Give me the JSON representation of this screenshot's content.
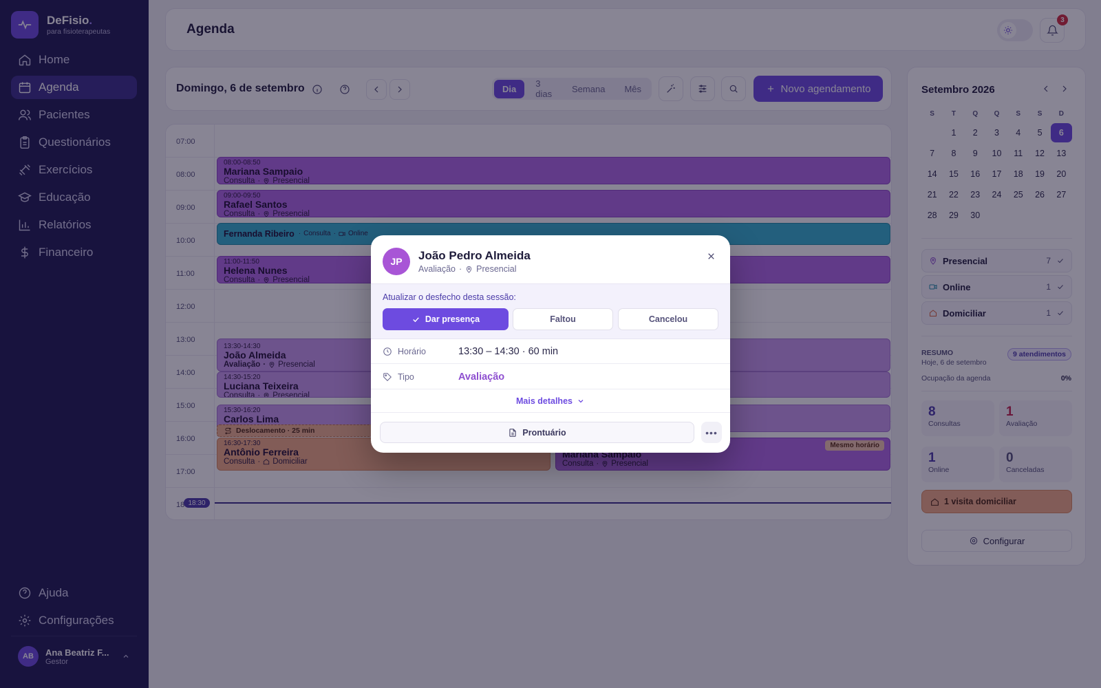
{
  "brand": {
    "name": "DeFisio",
    "dot": ".",
    "subtitle": "para fisioterapeutas"
  },
  "nav": {
    "items": [
      {
        "label": "Home",
        "icon": "home-icon"
      },
      {
        "label": "Agenda",
        "icon": "calendar-icon",
        "active": true
      },
      {
        "label": "Pacientes",
        "icon": "users-icon"
      },
      {
        "label": "Questionários",
        "icon": "clipboard-icon"
      },
      {
        "label": "Exercícios",
        "icon": "dumbbell-icon"
      },
      {
        "label": "Educação",
        "icon": "graduation-cap-icon"
      },
      {
        "label": "Relatórios",
        "icon": "bar-chart-icon"
      },
      {
        "label": "Financeiro",
        "icon": "dollar-icon"
      }
    ],
    "bottom": [
      {
        "label": "Ajuda",
        "icon": "help-circle-icon"
      },
      {
        "label": "Configurações",
        "icon": "gear-icon"
      }
    ]
  },
  "user": {
    "initials": "AB",
    "name": "Ana Beatriz F...",
    "role": "Gestor"
  },
  "header": {
    "title": "Agenda",
    "notification_count": "3"
  },
  "toolbar": {
    "date": "Domingo, 6 de setembro",
    "views": [
      "Dia",
      "3 dias",
      "Semana",
      "Mês"
    ],
    "active_view": "Dia",
    "new_button": "Novo agendamento"
  },
  "grid": {
    "hours": [
      "07:00",
      "08:00",
      "09:00",
      "10:00",
      "11:00",
      "12:00",
      "13:00",
      "14:00",
      "15:00",
      "16:00",
      "17:00",
      "18"
    ],
    "now": "18:30",
    "events": {
      "e1": {
        "time": "08:00-08:50",
        "name": "Mariana Sampaio",
        "type": "Consulta",
        "mode": "Presencial"
      },
      "e2": {
        "time": "09:00-09:50",
        "name": "Rafael Santos",
        "type": "Consulta",
        "mode": "Presencial"
      },
      "e3": {
        "name": "Fernanda Ribeiro",
        "type": "Consulta",
        "mode": "Online"
      },
      "e4": {
        "time": "11:00-11:50",
        "name": "Helena Nunes",
        "type": "Consulta",
        "mode": "Presencial"
      },
      "e5": {
        "time": "13:30-14:30",
        "name": "João Almeida",
        "type": "Avaliação",
        "mode": "Presencial"
      },
      "e6": {
        "time": "14:30-15:20",
        "name": "Luciana Teixeira",
        "type": "Consulta",
        "mode": "Presencial"
      },
      "e7": {
        "time": "15:30-16:20",
        "name": "Carlos Lima"
      },
      "e8": {
        "time": "16:30-17:30",
        "name": "Antônio Ferreira",
        "type": "Consulta",
        "mode": "Domiciliar"
      },
      "e9": {
        "name": "Mariana Sampaio",
        "type": "Consulta",
        "mode": "Presencial",
        "badge": "Mesmo horário"
      }
    },
    "travel": "Deslocamento · 25 min"
  },
  "mini_calendar": {
    "title": "Setembro 2026",
    "weekdays": [
      "S",
      "T",
      "Q",
      "Q",
      "S",
      "S",
      "D"
    ],
    "weeks": [
      [
        "",
        "1",
        "2",
        "3",
        "4",
        "5",
        "6"
      ],
      [
        "7",
        "8",
        "9",
        "10",
        "11",
        "12",
        "13"
      ],
      [
        "14",
        "15",
        "16",
        "17",
        "18",
        "19",
        "20"
      ],
      [
        "21",
        "22",
        "23",
        "24",
        "25",
        "26",
        "27"
      ],
      [
        "28",
        "29",
        "30",
        "",
        "",
        "",
        ""
      ]
    ],
    "selected": "6"
  },
  "filters": [
    {
      "label": "Presencial",
      "count": "7",
      "color": "#8e4fd0"
    },
    {
      "label": "Online",
      "count": "1",
      "color": "#1e8ca6"
    },
    {
      "label": "Domiciliar",
      "count": "1",
      "color": "#d9623b"
    }
  ],
  "summary": {
    "label": "RESUMO",
    "date": "Hoje, 6 de setembro",
    "badge": "9 atendimentos",
    "occupancy_label": "Ocupação da agenda",
    "occupancy_value": "0%",
    "stats": [
      {
        "num": "8",
        "label": "Consultas",
        "color": "#4a3aa8"
      },
      {
        "num": "1",
        "label": "Avaliação",
        "color": "#c2234a"
      },
      {
        "num": "1",
        "label": "Online",
        "color": "#4a3aa8"
      },
      {
        "num": "0",
        "label": "Canceladas",
        "color": "#55527a"
      }
    ],
    "home_visit": "1 visita domiciliar",
    "config": "Configurar"
  },
  "modal": {
    "initials": "JP",
    "name": "João Pedro Almeida",
    "type": "Avaliação",
    "mode": "Presencial",
    "outcome_label": "Atualizar o desfecho desta sessão:",
    "outcome_buttons": {
      "present": "Dar presença",
      "missed": "Faltou",
      "cancelled": "Cancelou"
    },
    "time_label": "Horário",
    "time_value": "13:30 – 14:30 · 60 min",
    "type_label": "Tipo",
    "type_value": "Avaliação",
    "more": "Mais detalhes",
    "record": "Prontuário"
  },
  "colors": {
    "accent": "#6d4be0",
    "sidebar": "#1f1a52",
    "presencial": "#b068e6",
    "online": "#35b3d0",
    "domiciliar": "#f3ac84"
  }
}
